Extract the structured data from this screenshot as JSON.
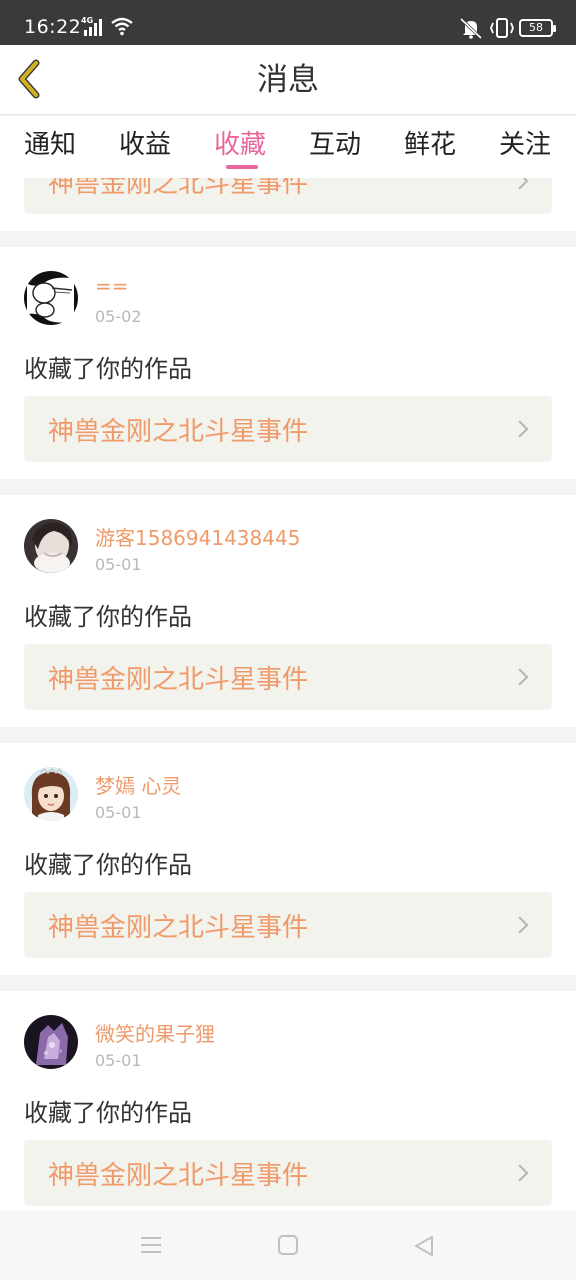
{
  "status_bar": {
    "time": "16:22",
    "network": "4G",
    "battery": "58"
  },
  "header": {
    "title": "消息"
  },
  "tabs": [
    {
      "label": "通知"
    },
    {
      "label": "收益"
    },
    {
      "label": "收藏",
      "active": true
    },
    {
      "label": "互动"
    },
    {
      "label": "鲜花"
    },
    {
      "label": "关注"
    }
  ],
  "top_partial": {
    "work_title": "神兽金刚之北斗星事件"
  },
  "messages": [
    {
      "user": "==",
      "date": "05-02",
      "action": "收藏了你的作品",
      "work_title": "神兽金刚之北斗星事件"
    },
    {
      "user": "游客1586941438445",
      "date": "05-01",
      "action": "收藏了你的作品",
      "work_title": "神兽金刚之北斗星事件"
    },
    {
      "user": "梦嫣 心灵",
      "date": "05-01",
      "action": "收藏了你的作品",
      "work_title": "神兽金刚之北斗星事件"
    },
    {
      "user": "微笑的果子狸",
      "date": "05-01",
      "action": "收藏了你的作品",
      "work_title": "神兽金刚之北斗星事件"
    }
  ],
  "icons": {
    "back": "chevron-left-icon",
    "item_arrow": "chevron-right-icon",
    "nav": [
      "menu-icon",
      "home-icon",
      "back-triangle-icon"
    ]
  },
  "colors": {
    "accent": "#e8669b",
    "username": "#ef9a6a",
    "work_title": "#ef9a6a",
    "back_icon": "#d4b020"
  }
}
